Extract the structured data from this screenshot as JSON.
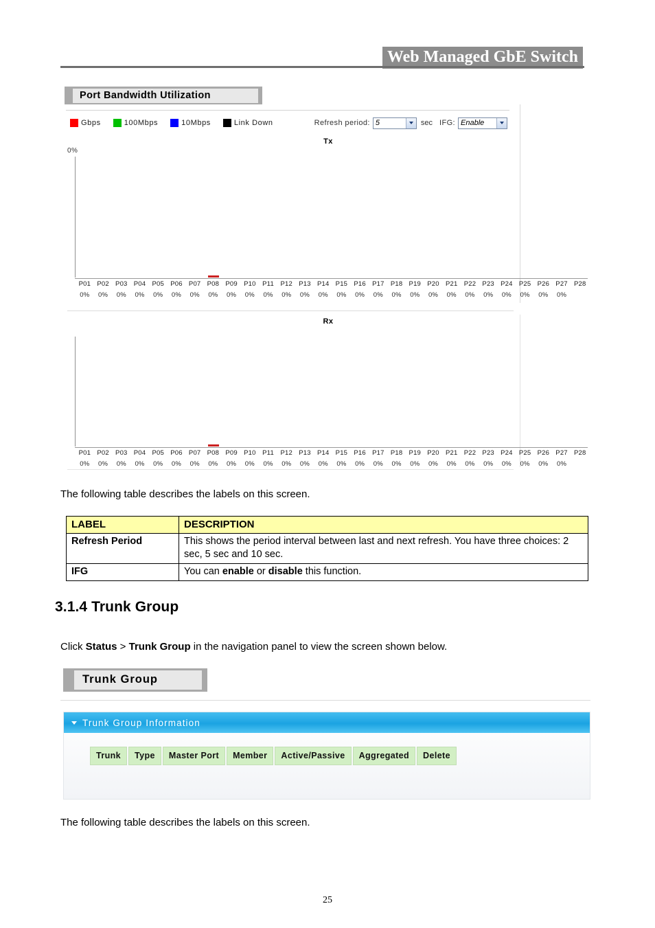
{
  "header": {
    "banner_title": "Web Managed GbE Switch"
  },
  "bandwidth_screen": {
    "window_title": "Port Bandwidth Utilization",
    "legend": [
      {
        "label": "Gbps",
        "color": "#ff0000",
        "icon": "legend-swatch-gbps"
      },
      {
        "label": "100Mbps",
        "color": "#00c000",
        "icon": "legend-swatch-100mbps"
      },
      {
        "label": "10Mbps",
        "color": "#0000ff",
        "icon": "legend-swatch-10mbps"
      },
      {
        "label": "Link Down",
        "color": "#000000",
        "icon": "legend-swatch-linkdown"
      }
    ],
    "refresh_period": {
      "label": "Refresh period:",
      "value": "5",
      "unit": "sec",
      "options": [
        "2",
        "5",
        "10"
      ]
    },
    "ifg": {
      "label": "IFG:",
      "value": "Enable",
      "options": [
        "Enable",
        "Disable"
      ]
    }
  },
  "chart_data": [
    {
      "type": "bar",
      "title": "Tx",
      "ylabel": "0%",
      "xlabel": "",
      "ylim": [
        0,
        100
      ],
      "grid": false,
      "legend_position": "top-left",
      "categories": [
        "P01",
        "P02",
        "P03",
        "P04",
        "P05",
        "P06",
        "P07",
        "P08",
        "P09",
        "P10",
        "P11",
        "P12",
        "P13",
        "P14",
        "P15",
        "P16",
        "P17",
        "P18",
        "P19",
        "P20",
        "P21",
        "P22",
        "P23",
        "P24",
        "P25",
        "P26",
        "P27",
        "P28"
      ],
      "values": [
        0,
        0,
        0,
        0,
        0,
        0,
        0,
        0,
        0,
        0,
        0,
        0,
        0,
        0,
        0,
        0,
        0,
        0,
        0,
        0,
        0,
        0,
        0,
        0,
        0,
        0,
        0,
        0
      ],
      "value_labels": [
        "0%",
        "0%",
        "0%",
        "0%",
        "0%",
        "0%",
        "0%",
        "0%",
        "0%",
        "0%",
        "0%",
        "0%",
        "0%",
        "0%",
        "0%",
        "0%",
        "0%",
        "0%",
        "0%",
        "0%",
        "0%",
        "0%",
        "0%",
        "0%",
        "0%",
        "0%",
        "0%",
        ""
      ],
      "bar_colors": [
        "none",
        "none",
        "none",
        "none",
        "none",
        "none",
        "none",
        "#cc2222",
        "none",
        "none",
        "none",
        "none",
        "none",
        "none",
        "none",
        "none",
        "none",
        "none",
        "none",
        "none",
        "none",
        "none",
        "none",
        "none",
        "none",
        "none",
        "none",
        "none"
      ]
    },
    {
      "type": "bar",
      "title": "Rx",
      "ylabel": "",
      "xlabel": "",
      "ylim": [
        0,
        100
      ],
      "grid": false,
      "legend_position": "top-left",
      "categories": [
        "P01",
        "P02",
        "P03",
        "P04",
        "P05",
        "P06",
        "P07",
        "P08",
        "P09",
        "P10",
        "P11",
        "P12",
        "P13",
        "P14",
        "P15",
        "P16",
        "P17",
        "P18",
        "P19",
        "P20",
        "P21",
        "P22",
        "P23",
        "P24",
        "P25",
        "P26",
        "P27",
        "P28"
      ],
      "values": [
        0,
        0,
        0,
        0,
        0,
        0,
        0,
        0,
        0,
        0,
        0,
        0,
        0,
        0,
        0,
        0,
        0,
        0,
        0,
        0,
        0,
        0,
        0,
        0,
        0,
        0,
        0,
        0
      ],
      "value_labels": [
        "0%",
        "0%",
        "0%",
        "0%",
        "0%",
        "0%",
        "0%",
        "0%",
        "0%",
        "0%",
        "0%",
        "0%",
        "0%",
        "0%",
        "0%",
        "0%",
        "0%",
        "0%",
        "0%",
        "0%",
        "0%",
        "0%",
        "0%",
        "0%",
        "0%",
        "0%",
        "0%",
        ""
      ],
      "bar_colors": [
        "none",
        "none",
        "none",
        "none",
        "none",
        "none",
        "none",
        "#cc2222",
        "none",
        "none",
        "none",
        "none",
        "none",
        "none",
        "none",
        "none",
        "none",
        "none",
        "none",
        "none",
        "none",
        "none",
        "none",
        "none",
        "none",
        "none",
        "none",
        "none"
      ]
    }
  ],
  "intro_text_1": "The following table describes the labels on this screen.",
  "label_table": {
    "headers": [
      "LABEL",
      "DESCRIPTION"
    ],
    "rows": [
      {
        "label": "Refresh Period",
        "description_parts": [
          {
            "text": "This shows the period interval between last and next refresh. You have three choices: 2 sec, 5 sec and 10 sec.",
            "bold": false
          }
        ]
      },
      {
        "label": "IFG",
        "description_parts": [
          {
            "text": "You can ",
            "bold": false
          },
          {
            "text": "enable",
            "bold": true
          },
          {
            "text": " or ",
            "bold": false
          },
          {
            "text": "disable",
            "bold": true
          },
          {
            "text": " this function.",
            "bold": false
          }
        ]
      }
    ]
  },
  "section": {
    "heading": "3.1.4 Trunk Group",
    "click_parts": [
      {
        "text": "Click ",
        "bold": false
      },
      {
        "text": "Status",
        "bold": true
      },
      {
        "text": " > ",
        "bold": false
      },
      {
        "text": "Trunk Group",
        "bold": true
      },
      {
        "text": " in the navigation panel to view the screen shown below.",
        "bold": false
      }
    ]
  },
  "trunk_screen": {
    "window_title": "Trunk Group",
    "panel_title": "Trunk Group Information",
    "panel_accent_color": "#1ba3e2",
    "table_header_color": "#d2efc4",
    "columns": [
      "Trunk",
      "Type",
      "Master Port",
      "Member",
      "Active/Passive",
      "Aggregated",
      "Delete"
    ],
    "rows": []
  },
  "intro_text_2": "The following table describes the labels on this screen.",
  "footer": {
    "page_number": "25"
  }
}
